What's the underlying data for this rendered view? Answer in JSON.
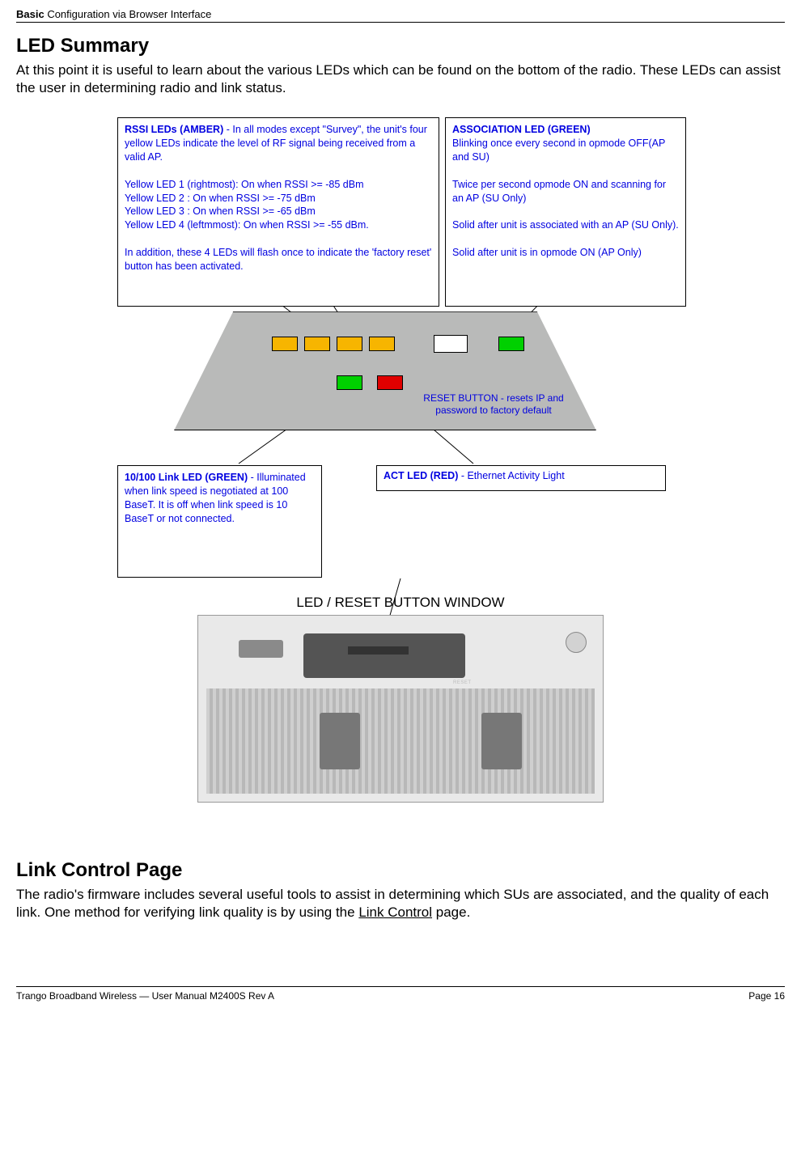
{
  "header": {
    "bold": "Basic",
    "rest": " Configuration via Browser Interface"
  },
  "led_summary": {
    "title": "LED Summary",
    "intro": "At this point it is useful to learn about the various LEDs which can be found on the bottom of the radio. These LEDs can assist the user in determining radio and link status."
  },
  "boxes": {
    "rssi_title": "RSSI LEDs (AMBER)",
    "rssi_rest1": "  - In all modes except \"Survey\", the unit's four yellow LEDs indicate the level of RF signal being received from a valid AP.",
    "rssi_lines": "Yellow LED 1 (rightmost): On when RSSI >=  -85 dBm\nYellow LED 2 : On when RSSI >= -75 dBm\nYellow LED 3 : On when RSSI >= -65 dBm\nYellow LED 4 (leftmmost): On when RSSI >= -55 dBm.",
    "rssi_tail": "In addition, these 4 LEDs will flash once to indicate the 'factory reset' button has been activated.",
    "assoc_title": "ASSOCIATION LED (GREEN)",
    "assoc_body": "Blinking once every second in opmode OFF(AP and SU)\n\nTwice per second opmode ON and scanning for an AP (SU Only)\n\nSolid after unit is associated with an AP (SU Only).\n\nSolid after unit is in opmode ON (AP Only)",
    "link_title": "10/100 Link LED  (GREEN)",
    "link_body": "   - Illuminated when link speed is negotiated at 100 BaseT. It is off when link speed is 10 BaseT or not connected.",
    "act_title": "ACT LED (RED)",
    "act_body": "  - Ethernet Activity Light",
    "reset_label": "RESET BUTTON - resets IP and password to factory default"
  },
  "caption": "LED / RESET BUTTON WINDOW",
  "link_control": {
    "title": "Link Control Page",
    "body_pre": "The radio's firmware includes several useful tools to assist in determining which SUs are associated, and the quality of each link.  One method for verifying link quality is by using the ",
    "body_link": "Link Control",
    "body_post": " page."
  },
  "footer": {
    "left": "Trango Broadband Wireless — User Manual M2400S Rev A",
    "right_label": "Page ",
    "right_num": "16"
  }
}
